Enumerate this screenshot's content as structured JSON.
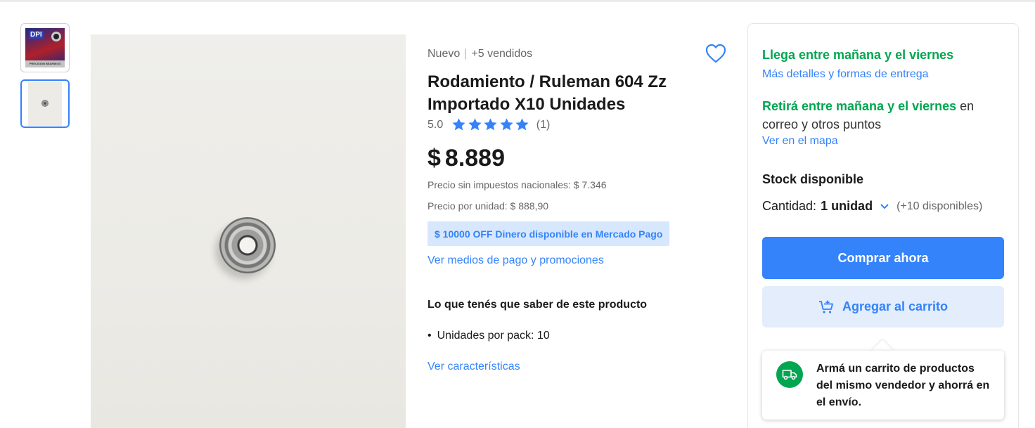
{
  "gallery": {
    "thumb1_logo": "DPI",
    "thumb1_caption": "PRECISION BEARINGS"
  },
  "product": {
    "condition": "Nuevo",
    "separator": "|",
    "sold": "+5 vendidos",
    "title": "Rodamiento / Ruleman 604 Zz Importado X10 Unidades",
    "rating_value": "5.0",
    "rating_stars": 5,
    "rating_count": "(1)",
    "currency": "$",
    "price": "8.889",
    "price_no_tax": "Precio sin impuestos nacionales: $ 7.346",
    "unit_price": "Precio por unidad: $ 888,90",
    "promo": "$ 10000 OFF Dinero disponible en Mercado Pago",
    "payment_link": "Ver medios de pago y promociones",
    "know_title": "Lo que tenés que saber de este producto",
    "bullet": "Unidades por pack: 10",
    "features_link": "Ver características"
  },
  "buybox": {
    "arrival": "Llega entre mañana y el viernes",
    "delivery_link": "Más detalles y formas de entrega",
    "pickup_green": "Retirá entre mañana y el viernes",
    "pickup_rest": " en correo y otros puntos",
    "map_link": "Ver en el mapa",
    "stock": "Stock disponible",
    "qty_label": "Cantidad:",
    "qty_value": "1 unidad",
    "qty_available": "(+10 disponibles)",
    "buy_button": "Comprar ahora",
    "cart_button": "Agregar al carrito",
    "tooltip": "Armá un carrito de productos del mismo vendedor y ahorrá en el envío."
  },
  "colors": {
    "accent": "#3483fa",
    "green": "#00a650",
    "promo_bg": "#d7e7fd"
  },
  "icons": [
    "heart-icon",
    "star-icon",
    "chevron-down-icon",
    "cart-plus-icon",
    "truck-icon"
  ]
}
